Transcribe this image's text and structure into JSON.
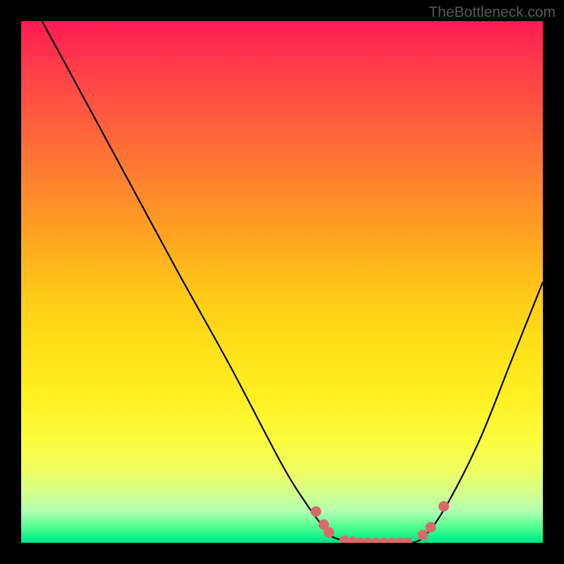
{
  "watermark": "TheBottleneck.com",
  "chart_data": {
    "type": "line",
    "title": "",
    "xlabel": "",
    "ylabel": "",
    "xlim": [
      0,
      100
    ],
    "ylim": [
      0,
      100
    ],
    "curve": {
      "name": "bottleneck-curve",
      "x": [
        4,
        10,
        20,
        30,
        40,
        50,
        55,
        58,
        60,
        65,
        70,
        75,
        78,
        82,
        88,
        94,
        100
      ],
      "y": [
        100,
        89,
        70.5,
        52,
        34,
        15,
        7,
        3,
        1,
        0,
        0,
        0,
        2,
        8,
        20,
        35,
        50
      ]
    },
    "markers": {
      "name": "highlight-points",
      "color": "#d86a6a",
      "points": [
        {
          "x": 56.5,
          "y": 6.0
        },
        {
          "x": 58.0,
          "y": 3.5
        },
        {
          "x": 59.0,
          "y": 2.0
        },
        {
          "x": 62.0,
          "y": 0.4
        },
        {
          "x": 63.5,
          "y": 0.2
        },
        {
          "x": 65.0,
          "y": 0.0
        },
        {
          "x": 66.5,
          "y": 0.0
        },
        {
          "x": 68.0,
          "y": 0.0
        },
        {
          "x": 69.5,
          "y": 0.0
        },
        {
          "x": 71.0,
          "y": 0.0
        },
        {
          "x": 72.5,
          "y": 0.0
        },
        {
          "x": 74.0,
          "y": 0.0
        },
        {
          "x": 77.0,
          "y": 1.5
        },
        {
          "x": 78.5,
          "y": 3.0
        },
        {
          "x": 81.0,
          "y": 7.0
        }
      ]
    }
  }
}
